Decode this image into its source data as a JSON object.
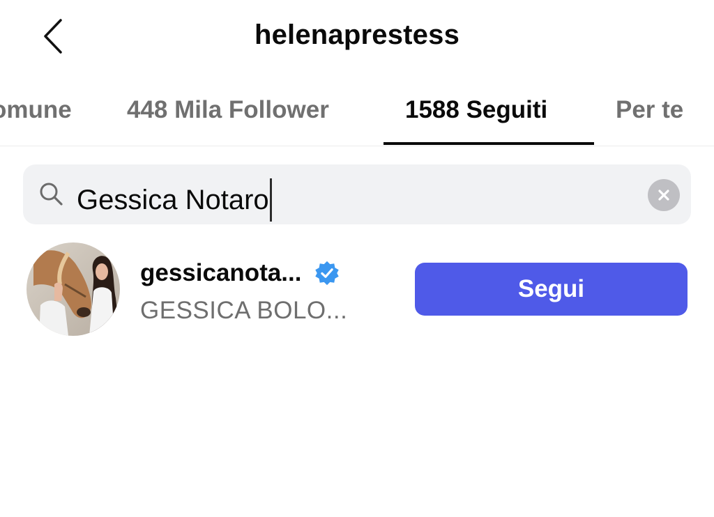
{
  "header": {
    "title": "helenaprestess",
    "back_icon": "chevron-left-icon"
  },
  "tabs": [
    {
      "label": "omune",
      "active": false
    },
    {
      "label": "448 Mila Follower",
      "active": false
    },
    {
      "label": "1588 Seguiti",
      "active": true
    },
    {
      "label": "Per te",
      "active": false
    }
  ],
  "search": {
    "value": "Gessica Notaro",
    "icon": "search-icon",
    "clear_icon": "clear-icon"
  },
  "results": [
    {
      "username": "gessicanota...",
      "full_name": "GESSICA BOLO...",
      "verified": true,
      "follow_label": "Segui"
    }
  ],
  "colors": {
    "accent": "#4f5ae8",
    "verified_badge": "#3b97f0",
    "muted_text": "#707070",
    "search_bg": "#f1f2f4"
  }
}
